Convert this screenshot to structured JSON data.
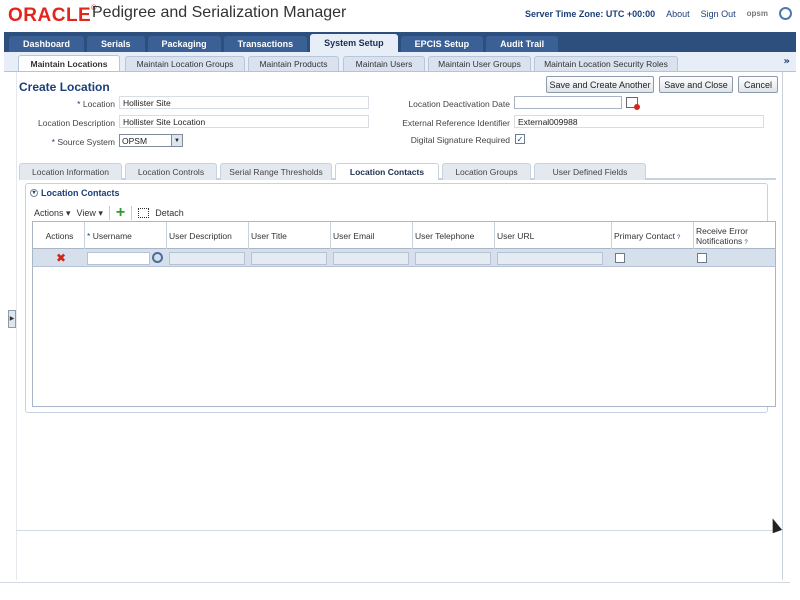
{
  "header": {
    "logo_text": "ORACLE",
    "app_title": "Pedigree and Serialization Manager",
    "server_time": "Server Time Zone: UTC +00:00",
    "about": "About",
    "sign_out": "Sign Out",
    "user": "opsm"
  },
  "main_tabs": [
    "Dashboard",
    "Serials",
    "Packaging",
    "Transactions",
    "System Setup",
    "EPCIS Setup",
    "Audit Trail"
  ],
  "sub_tabs": [
    "Maintain Locations",
    "Maintain Location Groups",
    "Maintain Products",
    "Maintain Users",
    "Maintain User Groups",
    "Maintain Location Security Roles"
  ],
  "sub_more": "»",
  "page": {
    "title": "Create Location",
    "buttons": {
      "save_create_another": "Save and Create Another",
      "save_close": "Save and Close",
      "cancel": "Cancel"
    }
  },
  "form": {
    "location_label": "Location",
    "location_value": "Hollister Site",
    "description_label": "Location Description",
    "description_value": "Hollister Site Location",
    "source_label": "Source System",
    "source_value": "OPSM",
    "deactivation_label": "Location Deactivation Date",
    "deactivation_value": "",
    "ext_ref_label": "External Reference Identifier",
    "ext_ref_value": "External009988",
    "digital_sig_label": "Digital Signature Required",
    "digital_sig_checked": true,
    "required_marker": "*"
  },
  "detail_tabs": [
    "Location Information",
    "Location Controls",
    "Serial Range Thresholds",
    "Location Contacts",
    "Location Groups",
    "User Defined Fields"
  ],
  "panel": {
    "title": "Location Contacts",
    "toolbar": {
      "actions": "Actions ▾",
      "view": "View ▾",
      "detach": "Detach"
    },
    "columns": {
      "actions": "Actions",
      "username": "Username",
      "user_description": "User Description",
      "user_title": "User Title",
      "user_email": "User Email",
      "user_telephone": "User Telephone",
      "user_url": "User URL",
      "primary_contact": "Primary Contact",
      "receive_error": "Receive Error Notifications"
    }
  },
  "colors": {
    "brand_red": "#e2261c",
    "nav_blue": "#2c4f7e",
    "link_blue": "#1b3f7a",
    "row_highlight": "#d6dfec"
  }
}
